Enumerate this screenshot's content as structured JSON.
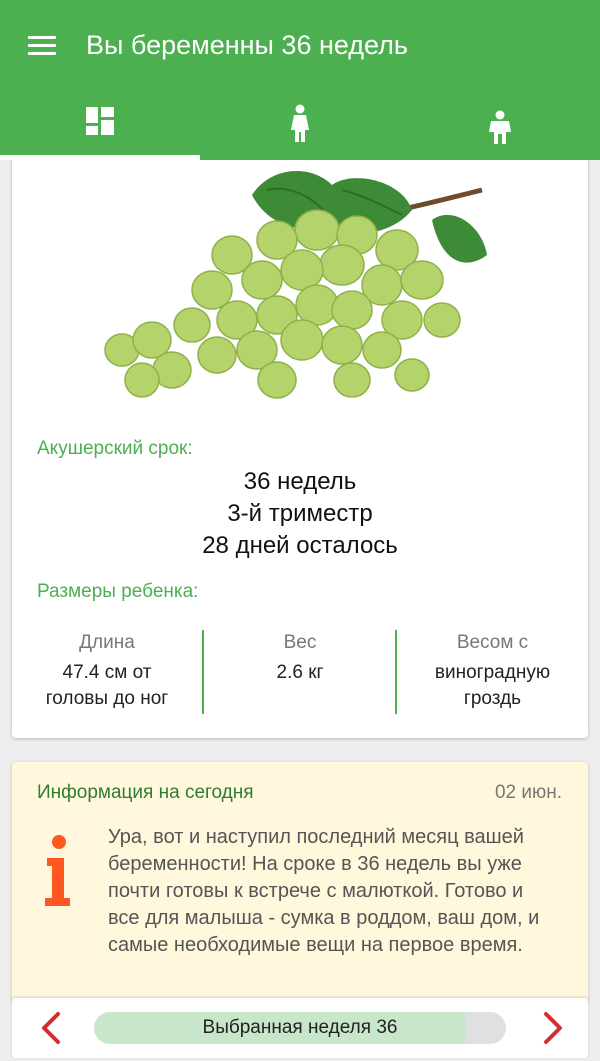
{
  "header": {
    "title": "Вы беременны 36 недель",
    "tabs": [
      {
        "icon": "dashboard-icon",
        "active": true
      },
      {
        "icon": "pregnant-woman-icon",
        "active": false
      },
      {
        "icon": "child-icon",
        "active": false
      }
    ]
  },
  "summary": {
    "image": "grapes-image",
    "term_label": "Акушерский срок:",
    "term_lines": [
      "36 недель",
      "3-й триместр",
      "28 дней осталось"
    ],
    "size_label": "Размеры ребенка:",
    "stats": [
      {
        "head": "Длина",
        "value_lines": [
          "47.4 см от",
          "головы до ног"
        ]
      },
      {
        "head": "Вес",
        "value_lines": [
          "2.6 кг"
        ]
      },
      {
        "head": "Весом с",
        "value_lines": [
          "виноградную",
          "гроздь"
        ]
      }
    ]
  },
  "info": {
    "title": "Информация на сегодня",
    "date": "02 июн.",
    "text": "Ура, вот и наступил последний месяц вашей беременности! На сроке в 36 недель вы уже почти готовы к встрече с малюткой. Готово и все для малыша - сумка в роддом, ваш дом, и самые необходимые вещи на первое время.",
    "icon": "info-i-icon"
  },
  "bottom": {
    "label": "Выбранная неделя 36",
    "progress_fraction": 0.9
  },
  "colors": {
    "primary": "#4caf50",
    "info_bg": "#fff8dc",
    "arrow": "#d32f2f",
    "info_icon": "#ff5722"
  }
}
